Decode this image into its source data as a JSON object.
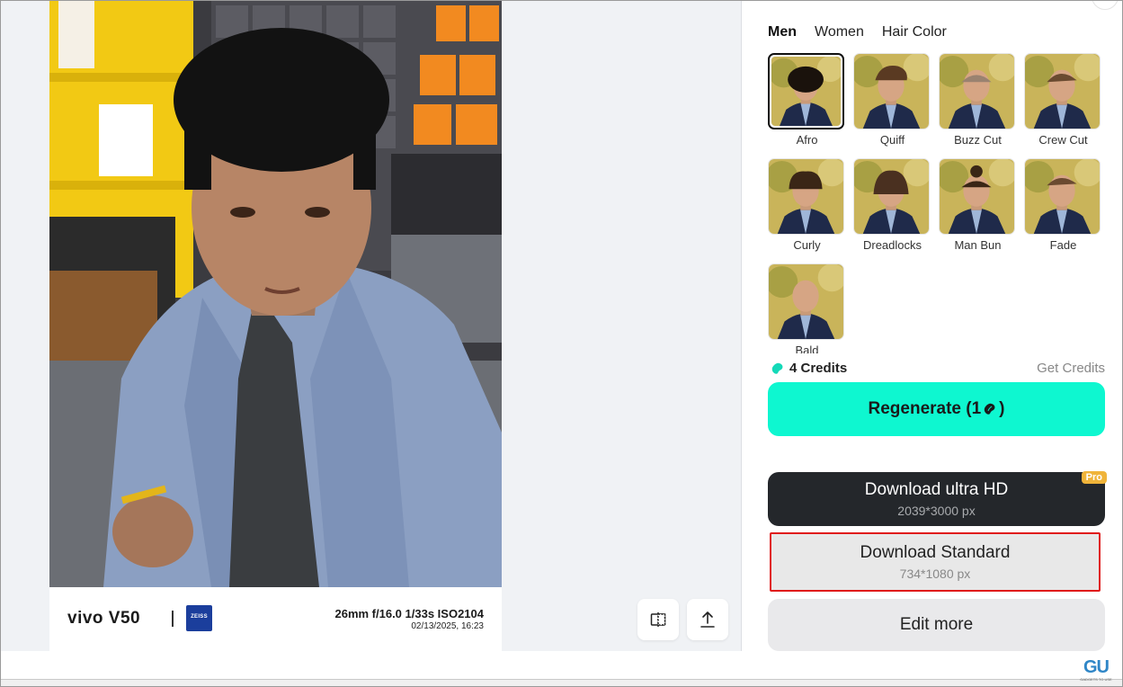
{
  "colors": {
    "accent": "#0ef7d0",
    "dark_button": "#24272b",
    "pro_badge": "#f0b43a",
    "highlight_border": "#e01b1b",
    "zeiss_blue": "#1b3e9c",
    "watermark_blue": "#2f86c7"
  },
  "photo": {
    "brand": "vivo V50",
    "zeiss": "ZEISS",
    "specs": "26mm  f/16.0  1/33s  ISO2104",
    "date": "02/13/2025, 16:23"
  },
  "toolbar": {
    "compare_icon": "compare-split-icon",
    "share_icon": "upload-share-icon"
  },
  "tabs": [
    {
      "label": "Men",
      "active": true
    },
    {
      "label": "Women",
      "active": false
    },
    {
      "label": "Hair Color",
      "active": false
    }
  ],
  "styles": [
    {
      "label": "Afro",
      "selected": true
    },
    {
      "label": "Quiff",
      "selected": false
    },
    {
      "label": "Buzz Cut",
      "selected": false
    },
    {
      "label": "Crew Cut",
      "selected": false
    },
    {
      "label": "Curly",
      "selected": false
    },
    {
      "label": "Dreadlocks",
      "selected": false
    },
    {
      "label": "Man Bun",
      "selected": false
    },
    {
      "label": "Fade",
      "selected": false
    },
    {
      "label": "Bald",
      "selected": false
    }
  ],
  "credits": {
    "icon": "bean-credit-icon",
    "count_label": "4 Credits",
    "get_label": "Get Credits"
  },
  "regenerate": {
    "label": "Regenerate (1",
    "suffix": ")"
  },
  "download_ultra": {
    "label": "Download ultra HD",
    "size": "2039*3000 px",
    "badge": "Pro"
  },
  "download_standard": {
    "label": "Download Standard",
    "size": "734*1080 px"
  },
  "edit_more": {
    "label": "Edit more"
  },
  "watermark": {
    "mark": "GU",
    "text": "GADGETS TO USE"
  }
}
